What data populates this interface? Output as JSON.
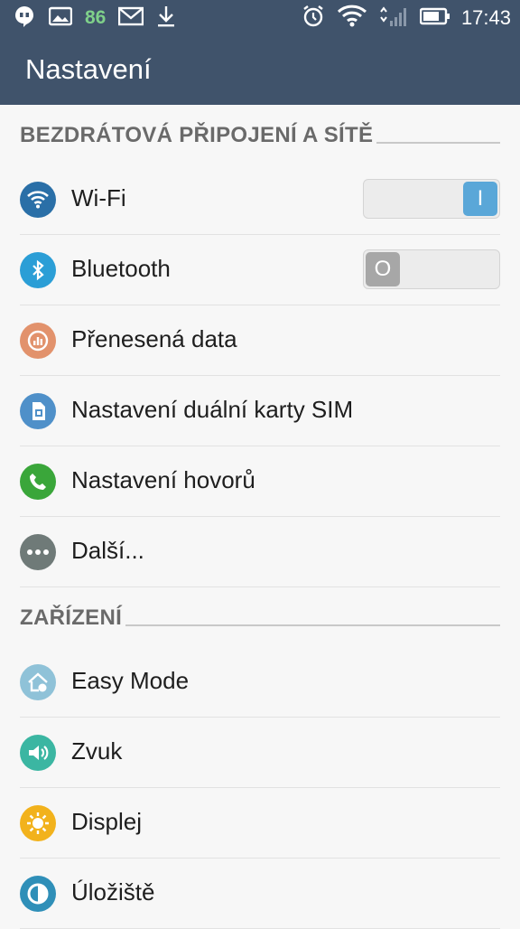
{
  "status_bar": {
    "notif_count": "86",
    "time": "17:43",
    "icons_left": [
      "hangouts-icon",
      "gallery-icon",
      "gmail-icon",
      "download-icon"
    ],
    "icons_right": [
      "alarm-icon",
      "wifi-icon",
      "cell-signal-icon",
      "battery-icon"
    ]
  },
  "app_bar": {
    "title": "Nastavení"
  },
  "sections": [
    {
      "label": "BEZDRÁTOVÁ PŘIPOJENÍ A SÍTĚ",
      "items": [
        {
          "label": "Wi-Fi",
          "icon": "wifi-icon",
          "color": "#2a6fa7",
          "toggle": true,
          "toggle_on": true,
          "toggle_text": "I"
        },
        {
          "label": "Bluetooth",
          "icon": "bluetooth-icon",
          "color": "#2b9ed6",
          "toggle": true,
          "toggle_on": false,
          "toggle_text": "O"
        },
        {
          "label": "Přenesená data",
          "icon": "data-usage-icon",
          "color": "#e2926c"
        },
        {
          "label": "Nastavení duální karty SIM",
          "icon": "sim-card-icon",
          "color": "#4f90c9"
        },
        {
          "label": "Nastavení hovorů",
          "icon": "phone-icon",
          "color": "#3aa63a"
        },
        {
          "label": "Další...",
          "icon": "more-icon",
          "color": "#6f7a78"
        }
      ]
    },
    {
      "label": "ZAŘÍZENÍ",
      "items": [
        {
          "label": "Easy Mode",
          "icon": "easy-mode-icon",
          "color": "#8fc2d8"
        },
        {
          "label": "Zvuk",
          "icon": "sound-icon",
          "color": "#3bb6a2"
        },
        {
          "label": "Displej",
          "icon": "display-icon",
          "color": "#f2b21c"
        },
        {
          "label": "Úložiště",
          "icon": "storage-icon",
          "color": "#2f8fb8"
        }
      ]
    }
  ]
}
